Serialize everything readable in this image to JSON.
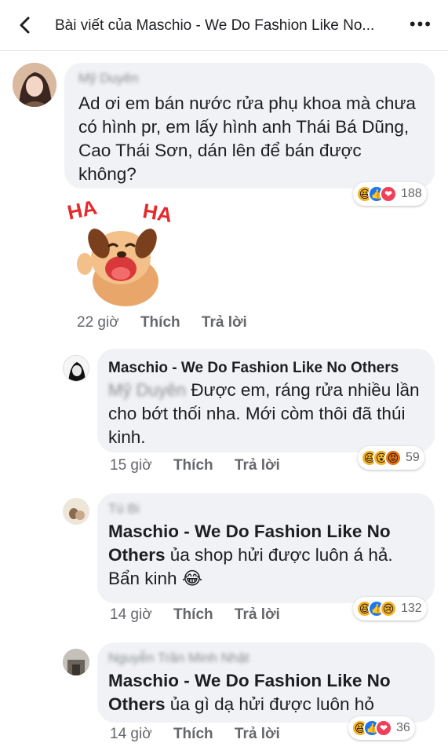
{
  "header": {
    "title": "Bài viết của Maschio - We Do Fashion Like No...",
    "back_icon": "back-chevron-icon",
    "more_icon": "more-dots-icon"
  },
  "comments": [
    {
      "name": "Mỹ Duyên",
      "text": "Ad ơi em bán nước rửa phụ khoa mà chưa có hình pr, em lấy hình anh Thái Bá Dũng, Cao Thái Sơn,  dán lên để bán được không?",
      "reactions": [
        "haha",
        "like",
        "love"
      ],
      "reaction_count": "188",
      "sticker_text_left": "HA",
      "sticker_text_right": "HA",
      "time": "22 giờ",
      "like_label": "Thích",
      "reply_label": "Trả lời"
    },
    {
      "name": "Maschio - We Do Fashion Like No Others",
      "mention": "Mỹ Duyên",
      "text": "Được em, ráng rửa nhiều lần cho bớt thối nha. Mới còm thôi đã thúi kinh.",
      "reactions": [
        "haha",
        "wow",
        "angry"
      ],
      "reaction_count": "59",
      "time": "15 giờ",
      "like_label": "Thích",
      "reply_label": "Trả lời"
    },
    {
      "name": "Tú Bi",
      "tag": "Maschio - We Do Fashion Like No Others",
      "text": " ủa shop hửi được luôn á hả. Bẩn kinh 😂",
      "reactions": [
        "haha",
        "like",
        "sad"
      ],
      "reaction_count": "132",
      "time": "14 giờ",
      "like_label": "Thích",
      "reply_label": "Trả lời"
    },
    {
      "name": "Nguyễn Trần Minh Nhật",
      "tag": "Maschio - We Do Fashion Like No Others",
      "text": " ủa gì dạ hửi được luôn hỏ",
      "reactions": [
        "haha",
        "like",
        "love"
      ],
      "reaction_count": "36",
      "time": "14 giờ",
      "like_label": "Thích",
      "reply_label": "Trả lời"
    }
  ]
}
